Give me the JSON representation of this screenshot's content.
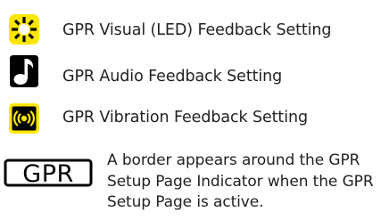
{
  "colors": {
    "icon_yellow": "#ffe600",
    "icon_black": "#000000",
    "text": "#231f20"
  },
  "settings": [
    {
      "icon": "led-icon",
      "label": "GPR Visual (LED) Feedback Setting"
    },
    {
      "icon": "music-note-icon",
      "label": "GPR Audio Feedback Setting"
    },
    {
      "icon": "vibration-icon",
      "label": "GPR Vibration Feedback Setting"
    }
  ],
  "indicator": {
    "icon_text": "GPR",
    "description": "A border appears around the GPR Setup Page Indicator when the GPR Setup Page is active."
  }
}
